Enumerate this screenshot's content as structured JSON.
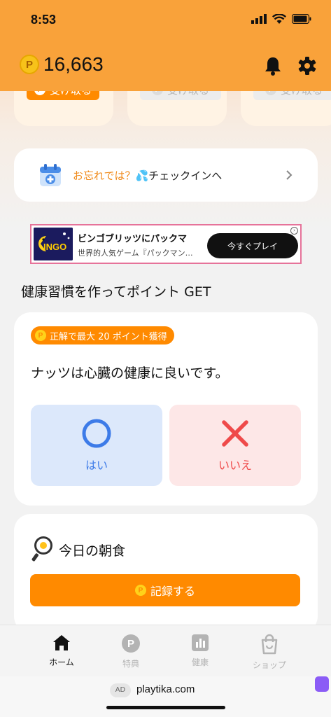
{
  "status_bar": {
    "time": "8:53"
  },
  "header": {
    "points": "16,663",
    "coin_letter": "P"
  },
  "claim_row": [
    {
      "label": "受け取る",
      "state": "active"
    },
    {
      "label": "受け取る",
      "state": "disabled"
    },
    {
      "label": "受け取る",
      "state": "disabled"
    }
  ],
  "checkin": {
    "highlight": "お忘れでは？",
    "rest": "チェックインへ"
  },
  "ad_banner": {
    "thumb_text": "INGO",
    "title": "ビンゴブリッツにパックマ",
    "subtitle": "世界的人気ゲーム『パックマン…",
    "cta": "今すぐプレイ"
  },
  "section_title": "健康習慣を作ってポイント GET",
  "quiz": {
    "badge": "正解で最大 20 ポイント獲得",
    "question": "ナッツは心臓の健康に良いです。",
    "yes_label": "はい",
    "no_label": "いいえ"
  },
  "breakfast": {
    "title": "今日の朝食",
    "button": "記録する"
  },
  "tabs": [
    {
      "label": "ホーム",
      "icon": "home-icon",
      "active": true
    },
    {
      "label": "特典",
      "icon": "points-icon",
      "active": false
    },
    {
      "label": "健康",
      "icon": "chart-icon",
      "active": false
    },
    {
      "label": "ショップ",
      "icon": "bag-icon",
      "active": false
    }
  ],
  "ad_footer": {
    "tag": "AD",
    "domain": "playtika.com"
  },
  "colors": {
    "header": "#f9a23a",
    "accent": "#ff8a00",
    "yes": "#3d7be8",
    "no": "#ef4a4a"
  }
}
